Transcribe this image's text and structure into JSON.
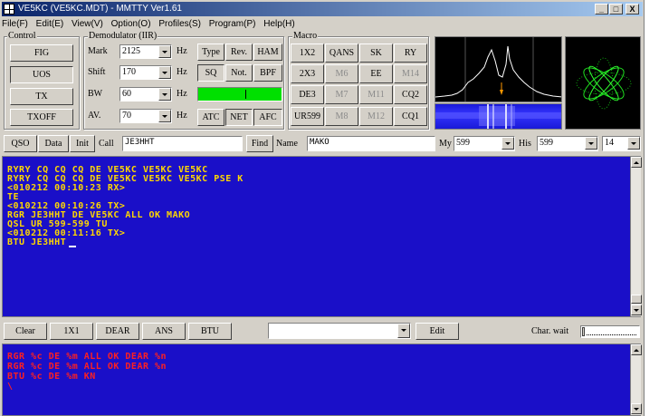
{
  "window": {
    "title": "VE5KC (VE5KC.MDT) - MMTTY Ver1.61",
    "min": "_",
    "max": "□",
    "close": "X"
  },
  "menu": [
    "File(F)",
    "Edit(E)",
    "View(V)",
    "Option(O)",
    "Profiles(S)",
    "Program(P)",
    "Help(H)"
  ],
  "control": {
    "label": "Control",
    "buttons": [
      "FIG",
      "UOS",
      "TX",
      "TXOFF"
    ]
  },
  "demod": {
    "label": "Demodulator (IIR)",
    "rows": [
      {
        "name": "Mark",
        "value": "2125",
        "unit": "Hz"
      },
      {
        "name": "Shift",
        "value": "170",
        "unit": "Hz"
      },
      {
        "name": "BW",
        "value": "60",
        "unit": "Hz"
      },
      {
        "name": "AV.",
        "value": "70",
        "unit": "Hz"
      }
    ],
    "buttons_row1": [
      "Type",
      "Rev.",
      "HAM"
    ],
    "buttons_row2": [
      "SQ",
      "Not.",
      "BPF"
    ],
    "buttons_row4": [
      "ATC",
      "NET",
      "AFC"
    ],
    "level_color": "#00e000"
  },
  "macro": {
    "label": "Macro",
    "buttons": [
      [
        "1X2",
        "QANS",
        "SK",
        "RY"
      ],
      [
        "2X3",
        "M6",
        "EE",
        "M14"
      ],
      [
        "DE3",
        "M7",
        "M11",
        "CQ2"
      ],
      [
        "UR599",
        "M8",
        "M12",
        "CQ1"
      ]
    ]
  },
  "qso": {
    "qso_btn": "QSO",
    "data_btn": "Data",
    "init_btn": "Init",
    "call_label": "Call",
    "call_value": "JE3HHT",
    "find_btn": "Find",
    "name_label": "Name",
    "name_value": "MAKO",
    "my_label": "My",
    "my_value": "599",
    "his_label": "His",
    "his_value": "599",
    "extra_value": "14"
  },
  "rx_lines": [
    "RYRY CQ CQ CQ DE VE5KC VE5KC VE5KC",
    "RYRY CQ CQ CQ DE VE5KC VE5KC VE5KC PSE K",
    "<010212 00:10:23 RX>",
    "TE",
    "<010212 00:10:26 TX>",
    "",
    "RGR JE3HHT DE VE5KC ALL OK MAKO",
    "",
    "QSL UR 599-599 TU",
    "",
    "<010212 00:11:16 TX>",
    "BTU JE3HHT"
  ],
  "tx_toolbar": {
    "buttons": [
      "Clear",
      "1X1",
      "DEAR",
      "ANS",
      "BTU"
    ],
    "edit_btn": "Edit",
    "charwait_label": "Char. wait"
  },
  "tx_lines": [
    "RGR %c DE %m ALL OK DEAR %n",
    "",
    "RGR %c DE %m ALL OK DEAR %n",
    "BTU %c DE %m KN",
    "\\"
  ],
  "colors": {
    "rx_bg": "#1a0fc8",
    "rx_text": "#ffd700",
    "tx_text": "#ff2020",
    "title_bar": "#0a246a"
  }
}
